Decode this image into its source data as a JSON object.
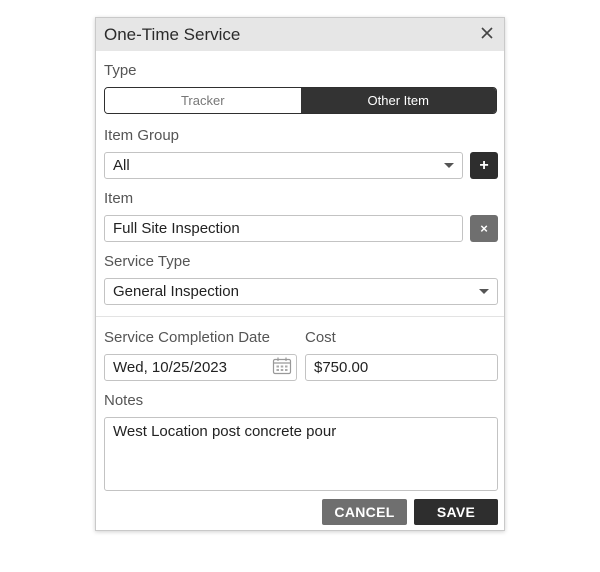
{
  "dialog": {
    "title": "One-Time Service",
    "close_icon": "close-icon"
  },
  "type": {
    "label": "Type",
    "options": [
      "Tracker",
      "Other Item"
    ],
    "selected": "Other Item"
  },
  "item_group": {
    "label": "Item Group",
    "value": "All",
    "add_label": "+"
  },
  "item": {
    "label": "Item",
    "value": "Full Site Inspection",
    "clear_label": "×"
  },
  "service_type": {
    "label": "Service Type",
    "value": "General Inspection"
  },
  "completion_date": {
    "label": "Service Completion Date",
    "value": "Wed, 10/25/2023",
    "icon": "calendar-icon"
  },
  "cost": {
    "label": "Cost",
    "value": "$750.00"
  },
  "notes": {
    "label": "Notes",
    "value": "West Location post concrete pour"
  },
  "actions": {
    "cancel_label": "CANCEL",
    "save_label": "SAVE"
  },
  "colors": {
    "dark": "#2e2e2e",
    "grey_button": "#6f6f6f",
    "titlebar": "#e6e6e6"
  }
}
